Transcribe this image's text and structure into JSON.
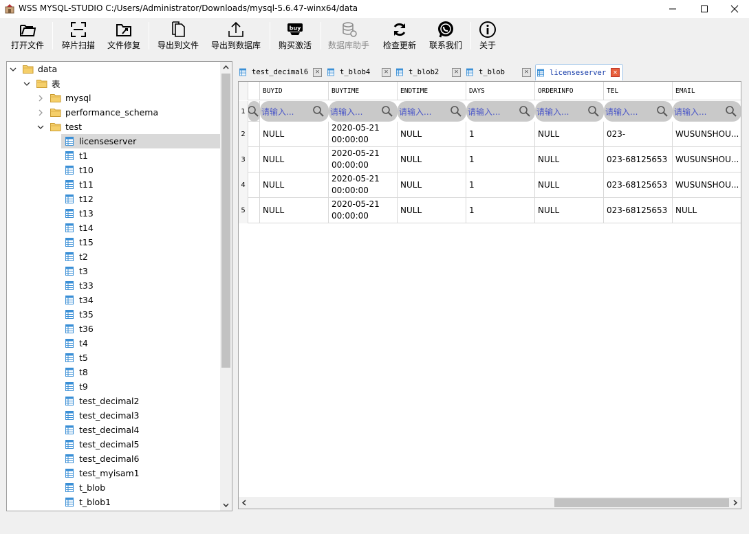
{
  "window": {
    "title": "WSS MYSQL-STUDIO  C:/Users/Administrator/Downloads/mysql-5.6.47-winx64/data"
  },
  "toolbar": {
    "open_file": "打开文件",
    "fragment_scan": "碎片扫描",
    "file_repair": "文件修复",
    "export_file": "导出到文件",
    "export_db": "导出到数据库",
    "buy_activate": "购买激活",
    "buy_badge": "buy",
    "db_assistant": "数据库助手",
    "check_update": "检查更新",
    "contact_us": "联系我们",
    "about": "关于"
  },
  "tree": {
    "root": "data",
    "tables_folder": "表",
    "databases": [
      "mysql",
      "performance_schema",
      "test"
    ],
    "test_tables": [
      "licenseserver",
      "t1",
      "t10",
      "t11",
      "t12",
      "t13",
      "t14",
      "t15",
      "t2",
      "t3",
      "t33",
      "t34",
      "t35",
      "t36",
      "t4",
      "t5",
      "t8",
      "t9",
      "test_decimal2",
      "test_decimal3",
      "test_decimal4",
      "test_decimal5",
      "test_decimal6",
      "test_myisam1",
      "t_blob",
      "t_blob1"
    ],
    "selected": "licenseserver"
  },
  "tabs": [
    {
      "label": "test_decimal6",
      "active": false
    },
    {
      "label": "t_blob4",
      "active": false
    },
    {
      "label": "t_blob2",
      "active": false
    },
    {
      "label": "t_blob",
      "active": false
    },
    {
      "label": "licenseserver",
      "active": true
    }
  ],
  "grid": {
    "columns": [
      "BUYID",
      "BUYTIME",
      "ENDTIME",
      "DAYS",
      "ORDERINFO",
      "TEL",
      "EMAIL"
    ],
    "filter_placeholder": "请输入...",
    "row_numbers": [
      "1",
      "2",
      "3",
      "4",
      "5"
    ],
    "rows": [
      [
        "NULL",
        "2020-05-21 00:00:00",
        "NULL",
        "1",
        "NULL",
        "023-",
        "WUSUNSHOU..."
      ],
      [
        "NULL",
        "2020-05-21 00:00:00",
        "NULL",
        "1",
        "NULL",
        "023-68125653",
        "WUSUNSHOU..."
      ],
      [
        "NULL",
        "2020-05-21 00:00:00",
        "NULL",
        "1",
        "NULL",
        "023-68125653",
        "WUSUNSHOU..."
      ],
      [
        "NULL",
        "2020-05-21 00:00:00",
        "NULL",
        "1",
        "NULL",
        "023-68125653",
        "NULL"
      ]
    ]
  },
  "colors": {
    "tab_active_border": "#9ec3e6",
    "filter_text": "#4a56c8",
    "tab_close_active": "#e8603c",
    "folder": "#e8b84a",
    "table_icon": "#3a8fd6"
  }
}
